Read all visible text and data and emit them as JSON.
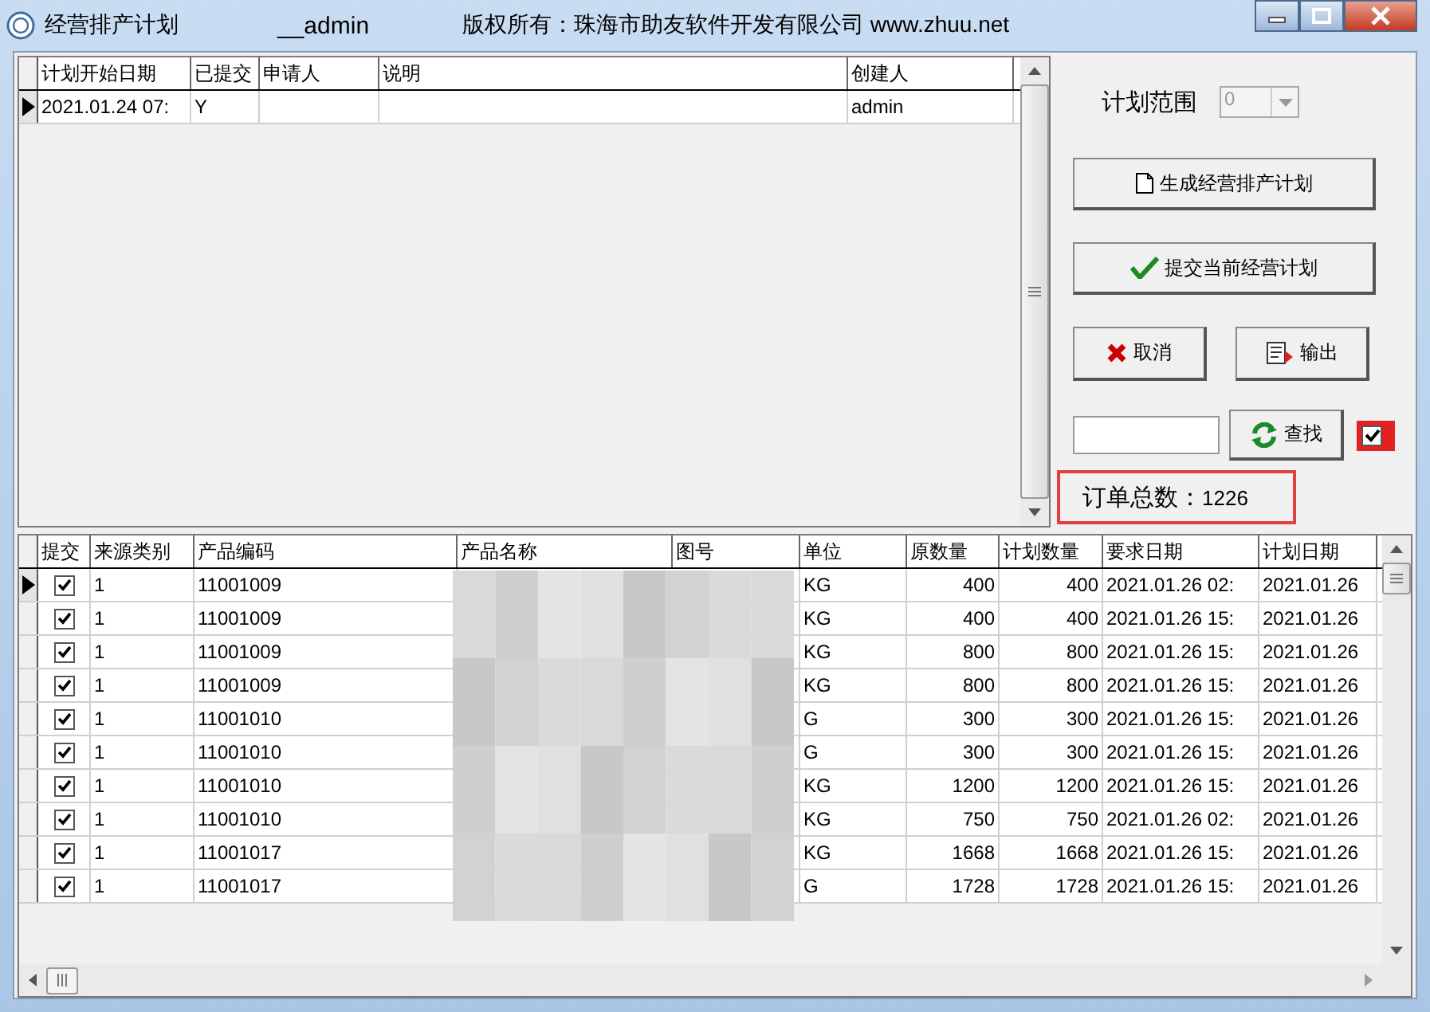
{
  "window": {
    "title": "经营排产计划",
    "user": "__admin",
    "copyright": "版权所有：珠海市助友软件开发有限公司 www.zhuu.net"
  },
  "plan_grid": {
    "columns": [
      "计划开始日期",
      "已提交",
      "申请人",
      "说明",
      "创建人"
    ],
    "rows": [
      {
        "selected": true,
        "start_date": "2021.01.24 07:",
        "submitted": "Y",
        "creator": "admin"
      }
    ]
  },
  "range": {
    "label": "计划范围",
    "value": "0",
    "disabled": true
  },
  "buttons": [
    {
      "label": "生成经营排产计划",
      "kind": "new"
    },
    {
      "label": "提交当前经营计划",
      "kind": "check"
    },
    {
      "label": "取消",
      "kind": "cancel"
    },
    {
      "label": "输出",
      "kind": "export"
    }
  ],
  "search": {
    "button": "查找",
    "checked": true
  },
  "order_total": {
    "label": "订单总数：",
    "value": "1226"
  },
  "order_grid": {
    "columns": [
      "提交",
      "来源类别",
      "产品编码",
      "产品名称",
      "图号",
      "单位",
      "原数量",
      "计划数量",
      "要求日期",
      "计划日期"
    ],
    "rows": [
      {
        "selected": true,
        "checked": true,
        "source": "1",
        "code": "11001009",
        "unit": "KG",
        "orig_qty": "400",
        "plan_qty": "400",
        "req_date": "2021.01.26 02:",
        "plan_date": "2021.01.26"
      },
      {
        "selected": false,
        "checked": true,
        "source": "1",
        "code": "11001009",
        "unit": "KG",
        "orig_qty": "400",
        "plan_qty": "400",
        "req_date": "2021.01.26 15:",
        "plan_date": "2021.01.26"
      },
      {
        "selected": false,
        "checked": true,
        "source": "1",
        "code": "11001009",
        "unit": "KG",
        "orig_qty": "800",
        "plan_qty": "800",
        "req_date": "2021.01.26 15:",
        "plan_date": "2021.01.26"
      },
      {
        "selected": false,
        "checked": true,
        "source": "1",
        "code": "11001009",
        "unit": "KG",
        "orig_qty": "800",
        "plan_qty": "800",
        "req_date": "2021.01.26 15:",
        "plan_date": "2021.01.26"
      },
      {
        "selected": false,
        "checked": true,
        "source": "1",
        "code": "11001010",
        "unit": "G",
        "orig_qty": "300",
        "plan_qty": "300",
        "req_date": "2021.01.26 15:",
        "plan_date": "2021.01.26"
      },
      {
        "selected": false,
        "checked": true,
        "source": "1",
        "code": "11001010",
        "unit": "G",
        "orig_qty": "300",
        "plan_qty": "300",
        "req_date": "2021.01.26 15:",
        "plan_date": "2021.01.26"
      },
      {
        "selected": false,
        "checked": true,
        "source": "1",
        "code": "11001010",
        "unit": "KG",
        "orig_qty": "1200",
        "plan_qty": "1200",
        "req_date": "2021.01.26 15:",
        "plan_date": "2021.01.26"
      },
      {
        "selected": false,
        "checked": true,
        "source": "1",
        "code": "11001010",
        "unit": "KG",
        "orig_qty": "750",
        "plan_qty": "750",
        "req_date": "2021.01.26 02:",
        "plan_date": "2021.01.26"
      },
      {
        "selected": false,
        "checked": true,
        "source": "1",
        "code": "11001017",
        "unit": "KG",
        "orig_qty": "1668",
        "plan_qty": "1668",
        "req_date": "2021.01.26 15:",
        "plan_date": "2021.01.26"
      },
      {
        "selected": false,
        "checked": true,
        "source": "1",
        "code": "11001017",
        "unit": "G",
        "orig_qty": "1728",
        "plan_qty": "1728",
        "req_date": "2021.01.26 15:",
        "plan_date": "2021.01.26"
      }
    ]
  }
}
